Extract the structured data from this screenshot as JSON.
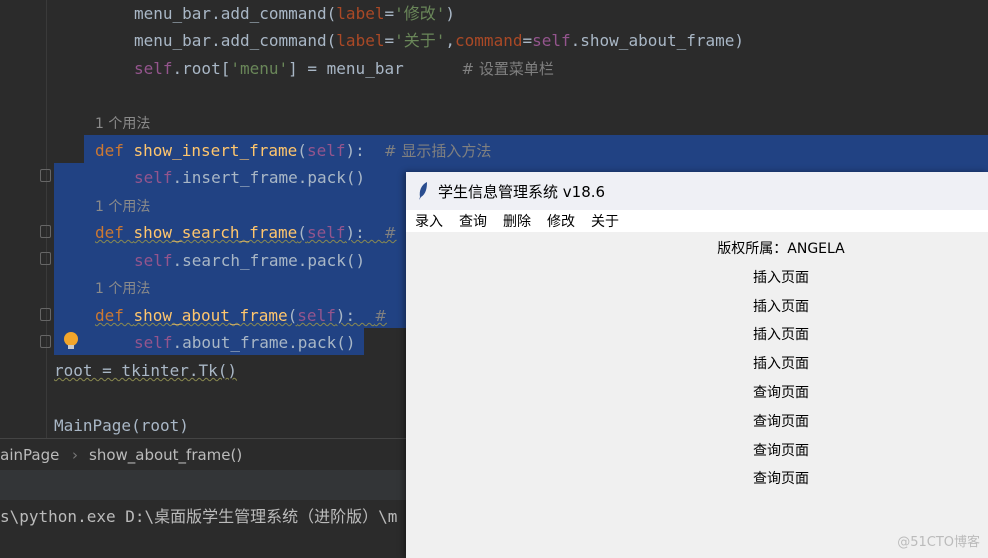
{
  "editor": {
    "lines": [
      [
        {
          "t": "menu_bar.add_command(",
          "c": "plain"
        },
        {
          "t": "label",
          "c": "param"
        },
        {
          "t": "=",
          "c": "plain"
        },
        {
          "t": "'修改'",
          "c": "str"
        },
        {
          "t": ")",
          "c": "plain"
        }
      ],
      [
        {
          "t": "menu_bar.add_command(",
          "c": "plain"
        },
        {
          "t": "label",
          "c": "param"
        },
        {
          "t": "=",
          "c": "plain"
        },
        {
          "t": "'关于'",
          "c": "str"
        },
        {
          "t": ",",
          "c": "plain"
        },
        {
          "t": "command",
          "c": "param"
        },
        {
          "t": "=",
          "c": "plain"
        },
        {
          "t": "self",
          "c": "self"
        },
        {
          "t": ".show_about_frame)",
          "c": "plain"
        }
      ],
      [
        {
          "t": "self",
          "c": "self"
        },
        {
          "t": ".root[",
          "c": "plain"
        },
        {
          "t": "'menu'",
          "c": "str"
        },
        {
          "t": "] = menu_bar      ",
          "c": "plain"
        },
        {
          "t": "# 设置菜单栏",
          "c": "cm"
        }
      ],
      [
        {
          "t": "1 个用法",
          "c": "hint"
        }
      ],
      [
        {
          "t": "def ",
          "c": "kw"
        },
        {
          "t": "show_insert_frame",
          "c": "fn"
        },
        {
          "t": "(",
          "c": "plain"
        },
        {
          "t": "self",
          "c": "self"
        },
        {
          "t": "):  ",
          "c": "plain"
        },
        {
          "t": "# 显示插入方法",
          "c": "cm"
        }
      ],
      [
        {
          "t": "self",
          "c": "self"
        },
        {
          "t": ".insert_frame.pack()",
          "c": "plain"
        }
      ],
      [
        {
          "t": "1 个用法",
          "c": "hint"
        }
      ],
      [
        {
          "t": "def ",
          "c": "kw"
        },
        {
          "t": "show_search_frame",
          "c": "fn"
        },
        {
          "t": "(",
          "c": "plain"
        },
        {
          "t": "self",
          "c": "self"
        },
        {
          "t": "):  ",
          "c": "plain"
        },
        {
          "t": "#",
          "c": "cm"
        }
      ],
      [
        {
          "t": "self",
          "c": "self"
        },
        {
          "t": ".search_frame.pack()",
          "c": "plain"
        }
      ],
      [
        {
          "t": "1 个用法",
          "c": "hint"
        }
      ],
      [
        {
          "t": "def ",
          "c": "kw"
        },
        {
          "t": "show_about_frame",
          "c": "fn"
        },
        {
          "t": "(",
          "c": "plain"
        },
        {
          "t": "self",
          "c": "self"
        },
        {
          "t": "):  ",
          "c": "plain"
        },
        {
          "t": "#",
          "c": "cm"
        }
      ],
      [
        {
          "t": "self",
          "c": "self"
        },
        {
          "t": ".about_frame.pack()",
          "c": "plain"
        }
      ],
      [
        {
          "t": "root = tkinter.Tk()",
          "c": "plain"
        }
      ],
      [
        {
          "t": "MainPage(root)",
          "c": "plain"
        }
      ]
    ],
    "breadcrumb": [
      "lainPage",
      "show_about_frame()"
    ],
    "terminal": "s\\python.exe D:\\桌面版学生管理系统（进阶版）\\m"
  },
  "tk_window": {
    "title": "学生信息管理系统 v18.6",
    "menu": [
      "录入",
      "查询",
      "删除",
      "修改",
      "关于"
    ],
    "labels": [
      "版权所属：ANGELA",
      "插入页面",
      "插入页面",
      "插入页面",
      "插入页面",
      "查询页面",
      "查询页面",
      "查询页面",
      "查询页面"
    ]
  },
  "watermark": "@51CTO博客",
  "colors": {
    "selection": "#214283",
    "editor_bg": "#2b2b2b",
    "keyword": "#cc7832",
    "function": "#ffc66d"
  }
}
